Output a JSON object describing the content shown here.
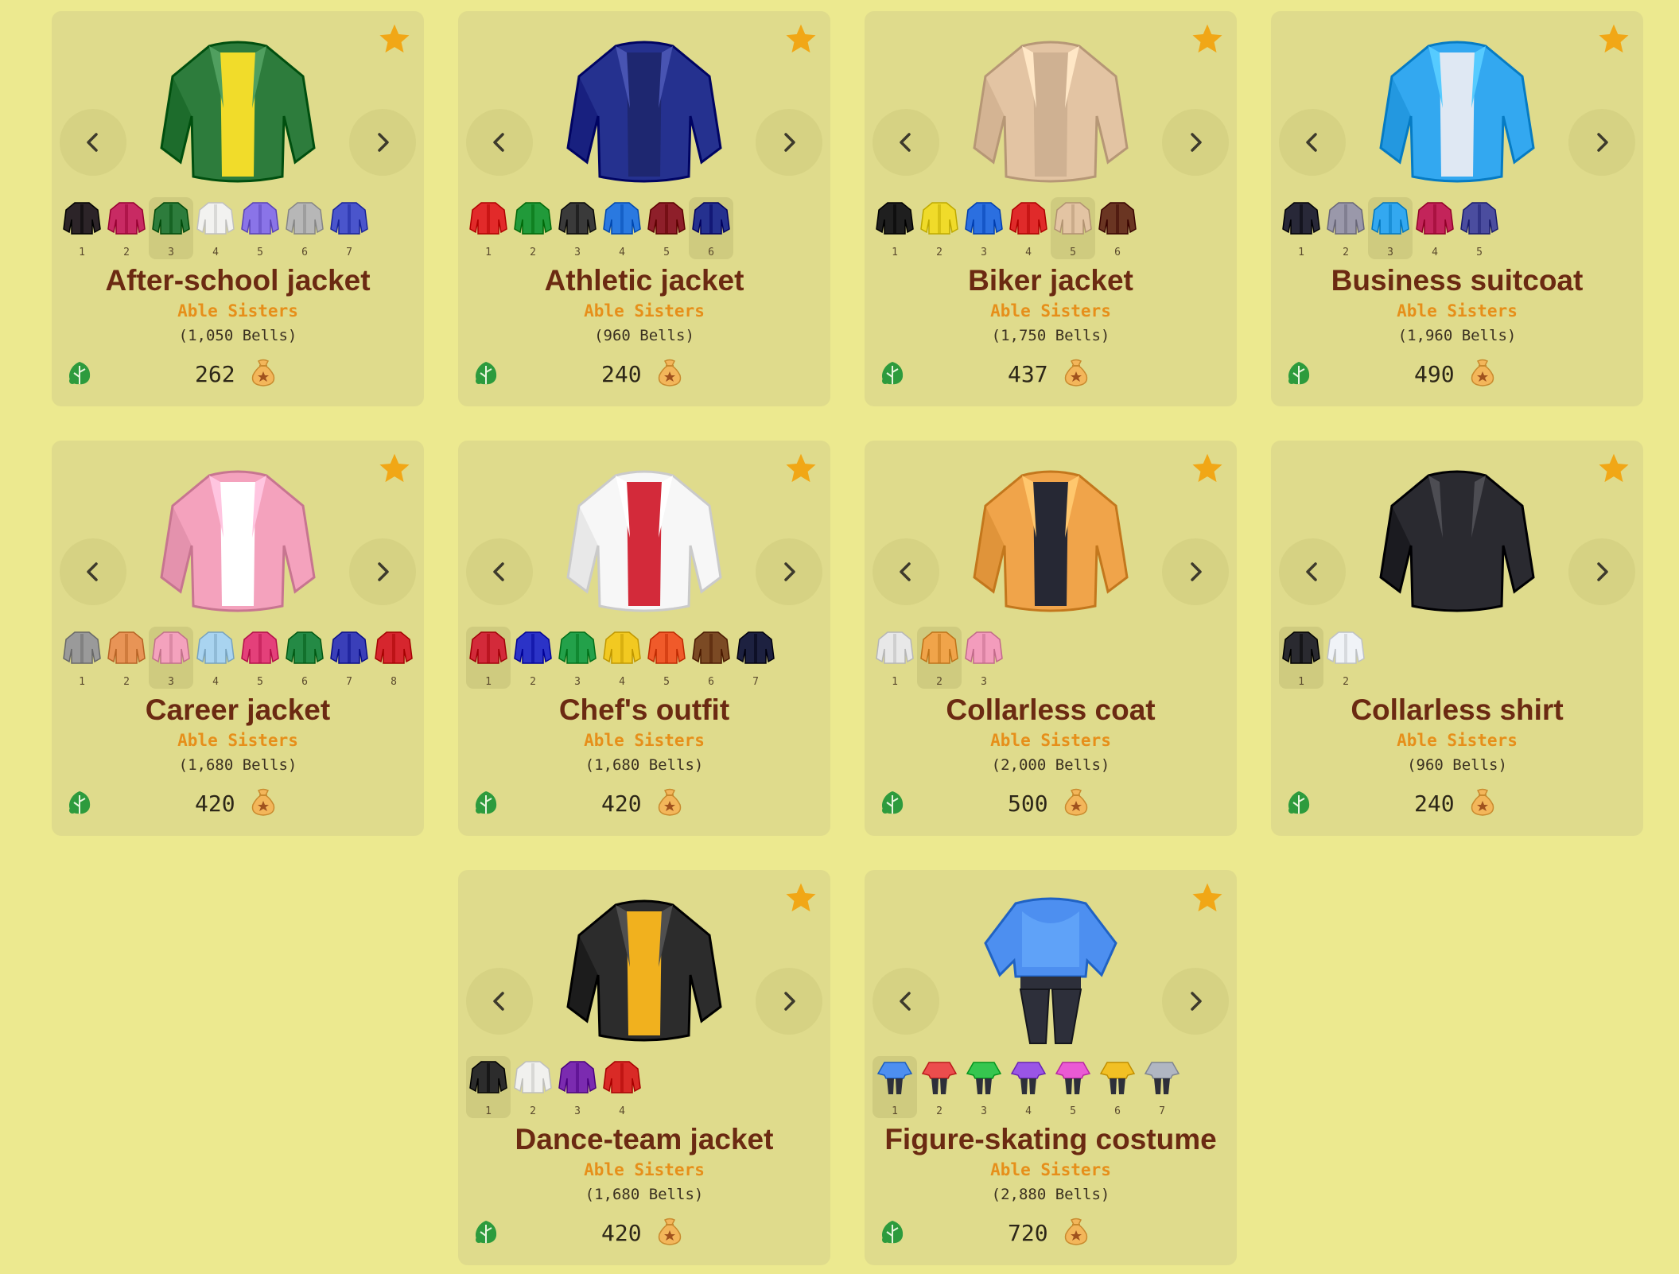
{
  "currency_icon": "bell-bag-icon",
  "acquire_icon": "nook-leaf-icon",
  "favorite_icon": "star-icon",
  "cards": [
    {
      "name": "After-school jacket",
      "shop": "Able Sisters",
      "price": "(1,050 Bells)",
      "miles": "262",
      "selected": 3,
      "main_color": "#2d7c3c",
      "inner_color": "#f1dc2a",
      "variants": [
        {
          "n": "1",
          "c": "#2c2428"
        },
        {
          "n": "2",
          "c": "#c82a63"
        },
        {
          "n": "3",
          "c": "#2d7c3c"
        },
        {
          "n": "4",
          "c": "#f2f2f0"
        },
        {
          "n": "5",
          "c": "#8a74e8"
        },
        {
          "n": "6",
          "c": "#b7b7b7"
        },
        {
          "n": "7",
          "c": "#4a55cc"
        }
      ]
    },
    {
      "name": "Athletic jacket",
      "shop": "Able Sisters",
      "price": "(960 Bells)",
      "miles": "240",
      "selected": 6,
      "main_color": "#25318f",
      "inner_color": "#1e2770",
      "variants": [
        {
          "n": "1",
          "c": "#e22a2a"
        },
        {
          "n": "2",
          "c": "#219a3a"
        },
        {
          "n": "3",
          "c": "#3a3a3a"
        },
        {
          "n": "4",
          "c": "#2a79e0"
        },
        {
          "n": "5",
          "c": "#8e1f2a"
        },
        {
          "n": "6",
          "c": "#25318f"
        }
      ]
    },
    {
      "name": "Biker jacket",
      "shop": "Able Sisters",
      "price": "(1,750 Bells)",
      "miles": "437",
      "selected": 5,
      "main_color": "#e3c4a3",
      "inner_color": "#cfb192",
      "variants": [
        {
          "n": "1",
          "c": "#1f1f1f"
        },
        {
          "n": "2",
          "c": "#f0db2a"
        },
        {
          "n": "3",
          "c": "#2b6fe0"
        },
        {
          "n": "4",
          "c": "#e02a2a"
        },
        {
          "n": "5",
          "c": "#e3c4a3"
        },
        {
          "n": "6",
          "c": "#6a3522"
        }
      ]
    },
    {
      "name": "Business suitcoat",
      "shop": "Able Sisters",
      "price": "(1,960 Bells)",
      "miles": "490",
      "selected": 3,
      "main_color": "#33a8f0",
      "inner_color": "#dfe8f3",
      "variants": [
        {
          "n": "1",
          "c": "#282838"
        },
        {
          "n": "2",
          "c": "#9a98aa"
        },
        {
          "n": "3",
          "c": "#33a8f0"
        },
        {
          "n": "4",
          "c": "#c3245a"
        },
        {
          "n": "5",
          "c": "#4b4d9f"
        }
      ]
    },
    {
      "name": "Career jacket",
      "shop": "Able Sisters",
      "price": "(1,680 Bells)",
      "miles": "420",
      "selected": 3,
      "main_color": "#f4a2bd",
      "inner_color": "#ffffff",
      "variants": [
        {
          "n": "1",
          "c": "#9a9a9a"
        },
        {
          "n": "2",
          "c": "#e89456"
        },
        {
          "n": "3",
          "c": "#f4a2bd"
        },
        {
          "n": "4",
          "c": "#a9d4f0"
        },
        {
          "n": "5",
          "c": "#e4407a"
        },
        {
          "n": "6",
          "c": "#248a45"
        },
        {
          "n": "7",
          "c": "#3a3fb9"
        },
        {
          "n": "8",
          "c": "#d6262e"
        }
      ]
    },
    {
      "name": "Chef's outfit",
      "shop": "Able Sisters",
      "price": "(1,680 Bells)",
      "miles": "420",
      "selected": 1,
      "main_color": "#f7f7f7",
      "inner_color": "#d32a3a",
      "variants": [
        {
          "n": "1",
          "c": "#d32a3a"
        },
        {
          "n": "2",
          "c": "#2b33c7"
        },
        {
          "n": "3",
          "c": "#23a14a"
        },
        {
          "n": "4",
          "c": "#f2c921"
        },
        {
          "n": "5",
          "c": "#f05a2a"
        },
        {
          "n": "6",
          "c": "#7b4a24"
        },
        {
          "n": "7",
          "c": "#1d2140"
        }
      ]
    },
    {
      "name": "Collarless coat",
      "shop": "Able Sisters",
      "price": "(2,000 Bells)",
      "miles": "500",
      "selected": 2,
      "main_color": "#f0a44a",
      "inner_color": "#262834",
      "variants": [
        {
          "n": "1",
          "c": "#e8e8e8"
        },
        {
          "n": "2",
          "c": "#f0a44a"
        },
        {
          "n": "3",
          "c": "#f39cbc"
        }
      ]
    },
    {
      "name": "Collarless shirt",
      "shop": "Able Sisters",
      "price": "(960 Bells)",
      "miles": "240",
      "selected": 1,
      "main_color": "#2a2a30",
      "inner_color": "#2a2a30",
      "variants": [
        {
          "n": "1",
          "c": "#2a2a30"
        },
        {
          "n": "2",
          "c": "#f0f3f7"
        }
      ]
    },
    {
      "name": "Dance-team jacket",
      "shop": "Able Sisters",
      "price": "(1,680 Bells)",
      "miles": "420",
      "selected": 1,
      "main_color": "#2c2c2c",
      "inner_color": "#f1b11e",
      "variants": [
        {
          "n": "1",
          "c": "#2c2c2c"
        },
        {
          "n": "2",
          "c": "#f1f1ee"
        },
        {
          "n": "3",
          "c": "#7b2bb0"
        },
        {
          "n": "4",
          "c": "#d92a26"
        }
      ]
    },
    {
      "name": "Figure-skating costume",
      "shop": "Able Sisters",
      "price": "(2,880 Bells)",
      "miles": "720",
      "selected": 1,
      "main_color": "#4d8ff0",
      "inner_color": "#2d2f3a",
      "variants": [
        {
          "n": "1",
          "c": "#4d8ff0"
        },
        {
          "n": "2",
          "c": "#ec4d4d"
        },
        {
          "n": "3",
          "c": "#36c64f"
        },
        {
          "n": "4",
          "c": "#9a55e6"
        },
        {
          "n": "5",
          "c": "#ea5ad4"
        },
        {
          "n": "6",
          "c": "#f2c024"
        },
        {
          "n": "7",
          "c": "#b0b6c2"
        }
      ]
    }
  ]
}
